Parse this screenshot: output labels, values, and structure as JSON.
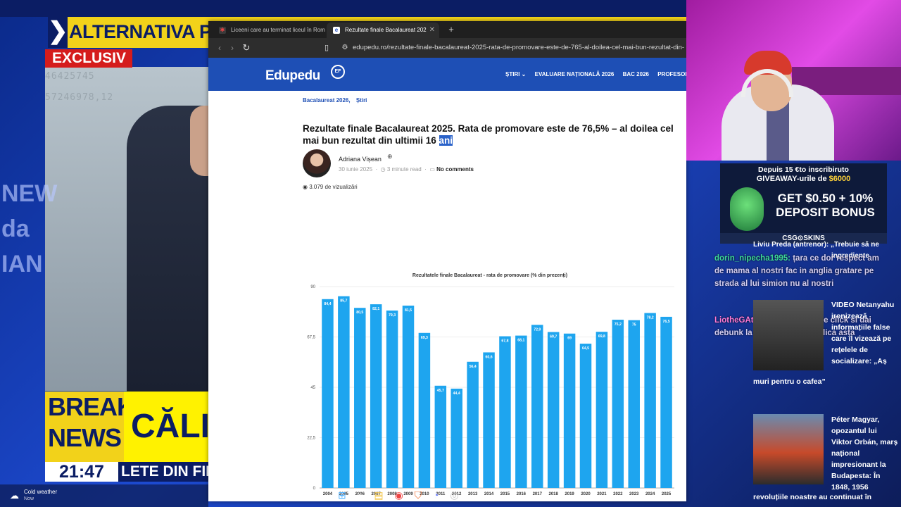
{
  "tv": {
    "headline_top": "ALTERNATIVA PATR",
    "exclusiv": "EXCLUSIV",
    "breaking_1": "BREAKING",
    "breaking_2": "NEWS",
    "breaking_name": "CĂLIN G",
    "clock": "21:47",
    "ticker_bottom": "LETE DIN FIEC",
    "wall_numbers": [
      "46425745",
      "57246978,12"
    ],
    "side_words": [
      "NEW",
      "da",
      "IAN"
    ]
  },
  "weather": {
    "icon": "cloud-icon",
    "title": "Cold weather",
    "time": "Now"
  },
  "browser": {
    "tabs": [
      {
        "title": "Liceeni care au terminat liceul în Rom",
        "icon": "site-icon"
      },
      {
        "title": "Rezultate finale Bacalaureat 202",
        "icon": "edupedu-icon",
        "active": true
      }
    ],
    "new_tab": "+",
    "url": "edupedu.ro/rezultate-finale-bacalaureat-2025-rata-de-promovare-este-de-765-al-doilea-cel-mai-bun-rezultat-din-"
  },
  "site": {
    "logo": "Edupedu",
    "logo_badge": "EF",
    "nav": [
      "ȘTIRI ⌄",
      "EVALUARE NAȚIONALĂ 2026",
      "BAC 2026",
      "PROFESOR"
    ],
    "categories": [
      "Bacalaureat 2026,",
      "Știri"
    ],
    "headline_main": "Rezultate finale Bacalaureat 2025. Rata de promovare este de 76,5% – al doilea cel mai bun rezultat din ultimii 16 ",
    "headline_sel": "ani",
    "author": "Adriana Vișean",
    "date": "30 iunie 2025",
    "read_time": "3 minute read",
    "comments": "No comments",
    "views": "3.079 de vizualizări"
  },
  "chart_data": {
    "type": "bar",
    "title": "Rezultatele finale Bacalaureat - rata de promovare (% din prezenți)",
    "categories": [
      "2004",
      "2005",
      "2006",
      "2007",
      "2008",
      "2009",
      "2010",
      "2011",
      "2012",
      "2013",
      "2014",
      "2015",
      "2016",
      "2017",
      "2018",
      "2019",
      "2020",
      "2021",
      "2022",
      "2023",
      "2024",
      "2025"
    ],
    "values": [
      84.4,
      85.7,
      80.5,
      82.1,
      79.3,
      81.5,
      69.3,
      45.7,
      44.4,
      56.4,
      60.6,
      67.8,
      68.1,
      72.9,
      69.7,
      69.0,
      64.5,
      69.8,
      75.2,
      75.0,
      78.2,
      76.5
    ],
    "data_labels": [
      "84,4",
      "85,7",
      "80,5",
      "82,1",
      "79,3",
      "81,5",
      "69,3",
      "45,7",
      "44,4",
      "56,4",
      "60,6",
      "67,8",
      "68,1",
      "72,9",
      "69,7",
      "69",
      "64,5",
      "69,8",
      "75,2",
      "75",
      "78,2",
      "76,5"
    ],
    "yticks": [
      "0",
      "22,5",
      "45",
      "67,5",
      "90"
    ],
    "ylim": [
      0,
      90
    ],
    "colors": {
      "bar": "#1ea5ef",
      "label": "#ffffff"
    }
  },
  "stream": {
    "promo_line1": "Depuis 15 €to inscribiruto",
    "promo_line2a": "GIVEAWAY-urile de ",
    "promo_line2b": "$6000",
    "promo_big1": "GET $0.50 + 10%",
    "promo_big2": "DEPOSIT BONUS",
    "promo_brand": "CSG⊙SKINS",
    "livu_a": "Liviu Preda (antrenor): „Trebuie să ne",
    "livu_b": "ingrediente",
    "chat": [
      {
        "user": "dorin_nipecha1995:",
        "text": "țara ce dor respect am de mama al nostri fac in anglia gratare pe strada  al lui simion nu al nostri"
      },
      {
        "user": "LiotheGAtotheCY:",
        "text": "o apasa de click si dai debunk la toate ale pe mosulica asta"
      }
    ],
    "news": [
      "VIDEO Netanyahu ironizează informațiile false care îl vizează pe rețelele de socializare: „Aș",
      "muri pentru o cafea”",
      "Péter Magyar, opozantul lui Viktor Orbán, marș național impresionant la Budapesta: În 1848, 1956",
      "revoluțiile noastre au continuat în"
    ]
  },
  "taskbar": [
    "windows-icon",
    "search-icon",
    "file-explorer-icon",
    "chrome-icon",
    "brave-icon",
    "discord-icon",
    "steam-icon"
  ]
}
